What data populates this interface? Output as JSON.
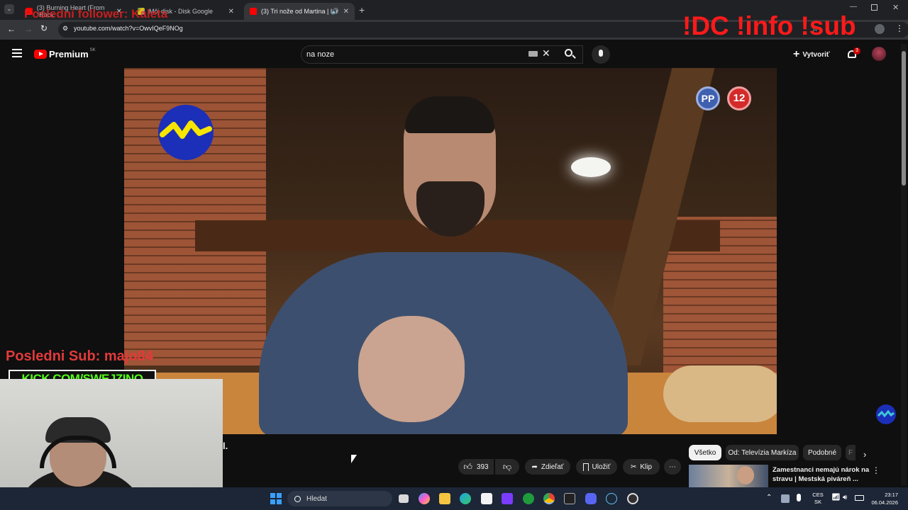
{
  "browser": {
    "tabs": [
      {
        "label": "(3) Burning Heart (From \"Rock"
      },
      {
        "label": "Môj disk - Disk Google"
      },
      {
        "label": "(3) Tri nože od Martina | Lu"
      }
    ],
    "url": "youtube.com/watch?v=OwvIQeF9NOg"
  },
  "youtube": {
    "logo_text": "Premium",
    "region": "SK",
    "search_value": "na noze",
    "create_label": "Vytvoriť",
    "notif_count": "3",
    "actions": {
      "likes": "393",
      "share": "Zdieľať",
      "save": "Uložiť",
      "clip": "Klip"
    },
    "title_fragment": "l.",
    "chips": [
      "Všetko",
      "Od: Televízia Markíza",
      "Podobné",
      "F"
    ],
    "recommendation": {
      "title_line1": "Zamestnanci nemajú nárok na",
      "title_line2": "stravu | Mestská piváreň ..."
    }
  },
  "video_overlay": {
    "badge_pp": "PP",
    "badge_age": "12"
  },
  "stream_overlay": {
    "follower_text": "Posledni follower: Kaleta",
    "commands_text": "!DC !info !sub",
    "sub_text": "Posledni Sub: majo84",
    "kick_text": "KICK.COM/SWEJZINO"
  },
  "taskbar": {
    "search_label": "Hledat",
    "lang_top": "CES",
    "lang_bottom": "SK",
    "time": "23:17",
    "date": "06.04.2026"
  },
  "colors": {
    "youtube_red": "#ff0000",
    "overlay_red": "#e02020",
    "markiza_blue": "#1b2fb8",
    "markiza_yellow": "#f6e600"
  }
}
